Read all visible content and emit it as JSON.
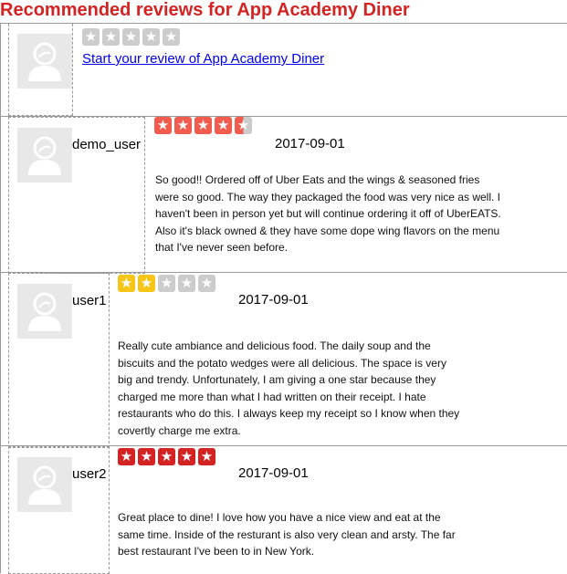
{
  "page": {
    "title": "Recommended reviews for App Academy Diner"
  },
  "start_review": {
    "link_label": "Start your review of App Academy Diner",
    "rating": 0
  },
  "reviews": [
    {
      "username": "demo_user",
      "rating": 4.5,
      "star_color": "#f15c4f",
      "date": "2017-09-01",
      "text": "So good!! Ordered off of Uber Eats and the wings & seasoned fries were so good. The way they packaged the food was very nice as well. I haven't been in person yet but will continue ordering it off of UberEATS. Also it's black owned & they have some dope wing flavors on the menu that I've never seen before."
    },
    {
      "username": "user1",
      "rating": 2,
      "star_color": "#f5c518",
      "date": "2017-09-01",
      "text": "Really cute ambiance and delicious food. The daily soup and the biscuits and the potato wedges were all delicious. The space is very big and trendy. Unfortunately, I am giving a one star because they charged me more than what I had written on their receipt. I hate restaurants who do this. I always keep my receipt so I know when they covertly charge me extra."
    },
    {
      "username": "user2",
      "rating": 5,
      "star_color": "#d32323",
      "date": "2017-09-01",
      "text": "Great place to dine! I love how you have a nice view and eat at the same time. Inside of the resturant is also very clean and arsty. The far best restaurant I've been to in New York."
    }
  ],
  "icons": {
    "star": "star-icon",
    "avatar": "default-avatar-icon"
  },
  "colors": {
    "title": "#d32323",
    "empty_star": "#cccccc",
    "link": "#0000ee"
  }
}
